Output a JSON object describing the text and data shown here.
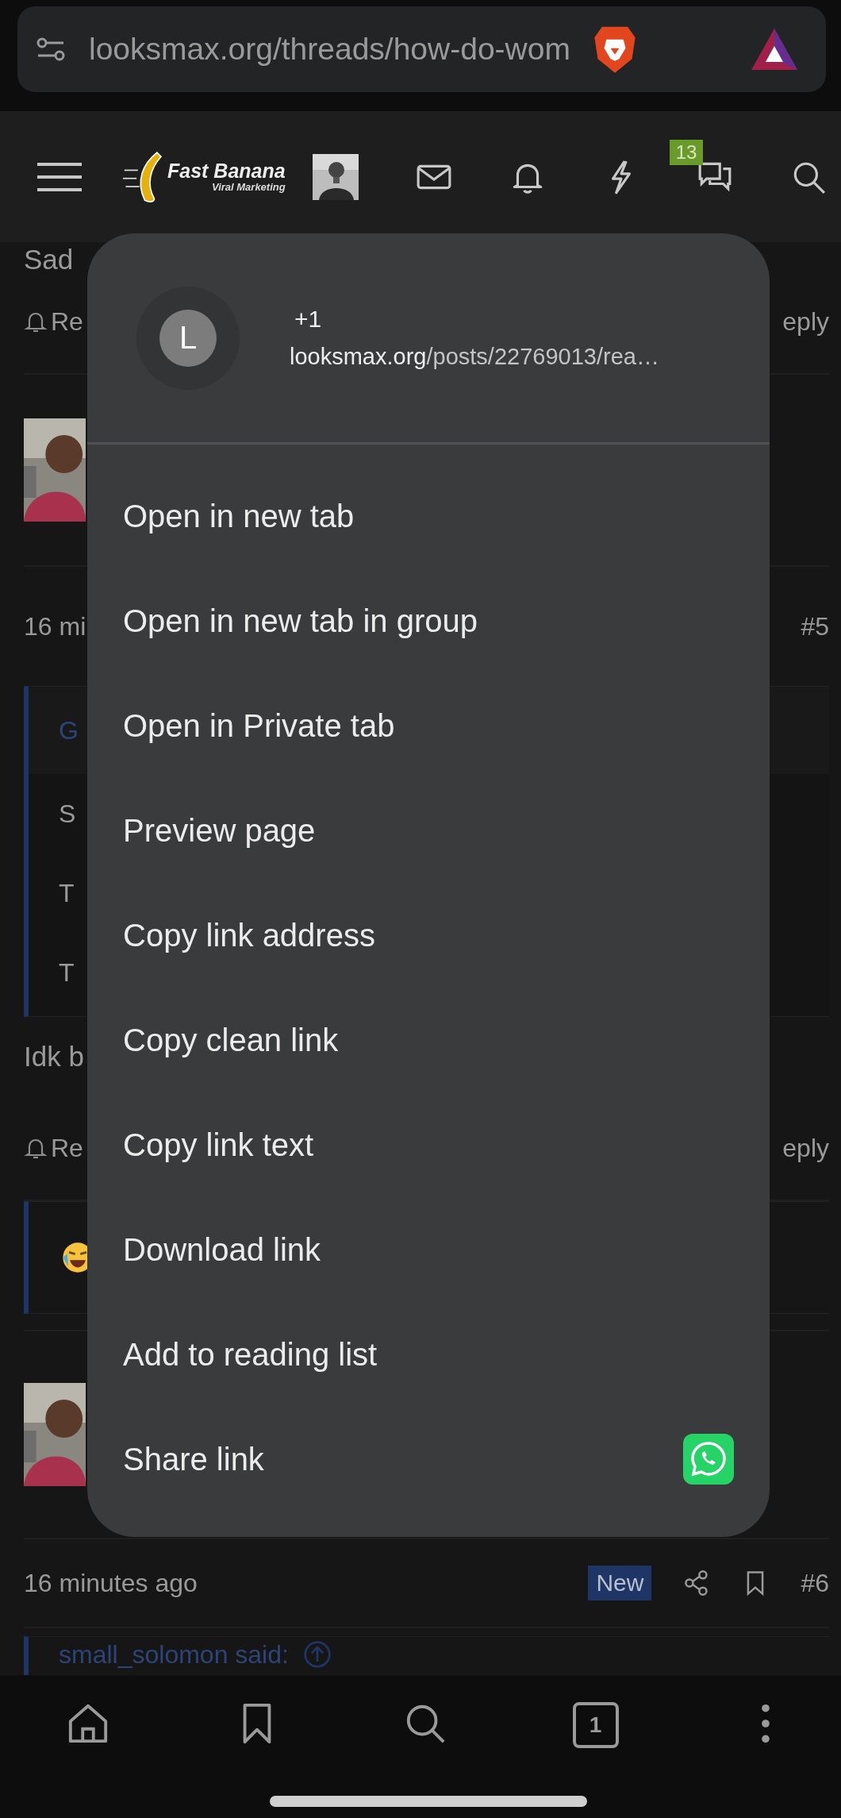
{
  "address_bar": {
    "url": "looksmax.org/threads/how-do-wom"
  },
  "site_header": {
    "logo_title": "Fast Banana",
    "logo_subtitle": "Viral Marketing",
    "badge": "13"
  },
  "thread": [
    {
      "kind": "text_cut",
      "text": "Sad"
    },
    {
      "kind": "actions",
      "left": "Re",
      "right": "eply"
    },
    {
      "kind": "avatar"
    },
    {
      "kind": "meta",
      "time": "16 mi",
      "number": "#5"
    },
    {
      "kind": "quote",
      "author": "G",
      "lines": [
        "S",
        "T",
        "T"
      ]
    },
    {
      "kind": "text",
      "text": "Idk b"
    },
    {
      "kind": "actions",
      "left": "Re",
      "right": "eply"
    },
    {
      "kind": "reaction"
    },
    {
      "kind": "avatar"
    },
    {
      "kind": "meta_full",
      "time": "16 minutes ago",
      "badge": "New",
      "number": "#6"
    },
    {
      "kind": "quote_head",
      "author": "small_solomon said:"
    }
  ],
  "context_menu": {
    "header": {
      "avatar_letter": "L",
      "title": "+1",
      "url_domain": "looksmax.org",
      "url_path": "/posts/22769013/rea…"
    },
    "items": [
      {
        "label": "Open in new tab",
        "kind": "plain"
      },
      {
        "label": "Open in new tab in group",
        "kind": "plain"
      },
      {
        "label": "Open in Private tab",
        "kind": "plain"
      },
      {
        "label": "Preview page",
        "kind": "plain"
      },
      {
        "label": "Copy link address",
        "kind": "plain"
      },
      {
        "label": "Copy clean link",
        "kind": "plain"
      },
      {
        "label": "Copy link text",
        "kind": "plain"
      },
      {
        "label": "Download link",
        "kind": "plain"
      },
      {
        "label": "Add to reading list",
        "kind": "plain"
      },
      {
        "label": "Share link",
        "kind": "share"
      }
    ]
  },
  "bottom_nav": {
    "tab_count": "1"
  }
}
